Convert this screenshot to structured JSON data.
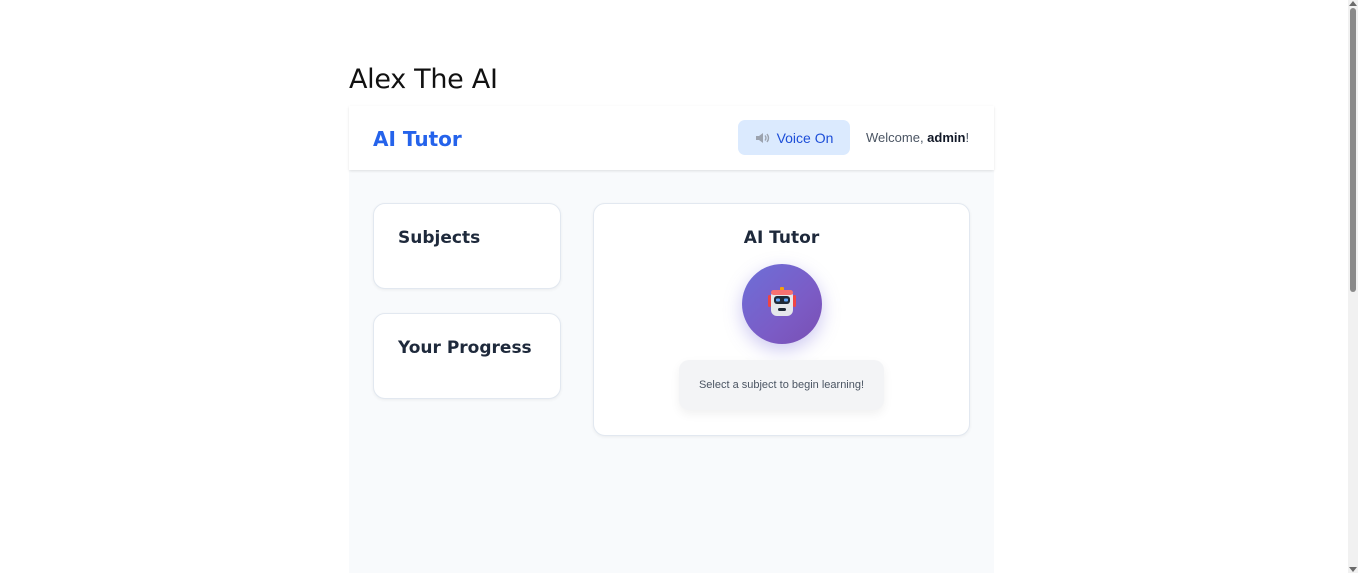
{
  "page": {
    "title": "Alex The AI"
  },
  "header": {
    "brand": "AI Tutor",
    "voice_button_label": "Voice On",
    "voice_icon": "speaker-icon",
    "welcome_prefix": "Welcome, ",
    "username": "admin",
    "welcome_suffix": "!"
  },
  "sidebar": {
    "subjects_title": "Subjects",
    "progress_title": "Your Progress"
  },
  "tutor": {
    "title": "AI Tutor",
    "avatar_icon": "robot-icon",
    "message": "Select a subject to begin learning!"
  },
  "colors": {
    "accent": "#2563eb",
    "voice_button_bg": "#dbeafe",
    "avatar_gradient_start": "#6d6fd8",
    "avatar_gradient_end": "#7a4fb3"
  }
}
